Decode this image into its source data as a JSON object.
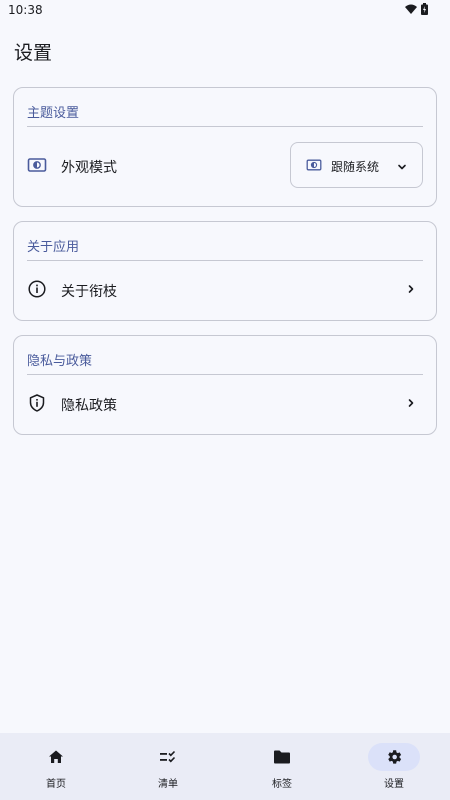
{
  "status_bar": {
    "time": "10:38"
  },
  "page": {
    "title": "设置"
  },
  "theme_card": {
    "header": "主题设置",
    "row_label": "外观模式",
    "dropdown_value": "跟随系统"
  },
  "about_card": {
    "header": "关于应用",
    "row_label": "关于衔枝"
  },
  "privacy_card": {
    "header": "隐私与政策",
    "row_label": "隐私政策"
  },
  "bottom_nav": {
    "items": [
      {
        "label": "首页",
        "icon": "home-icon"
      },
      {
        "label": "清单",
        "icon": "checklist-icon"
      },
      {
        "label": "标签",
        "icon": "folder-icon"
      },
      {
        "label": "设置",
        "icon": "gear-icon",
        "active": true
      }
    ]
  },
  "colors": {
    "accent": "#4a5b9c",
    "background": "#f7f8fd",
    "nav_background": "#eaecf6",
    "nav_active_pill": "#dbe1f9"
  }
}
